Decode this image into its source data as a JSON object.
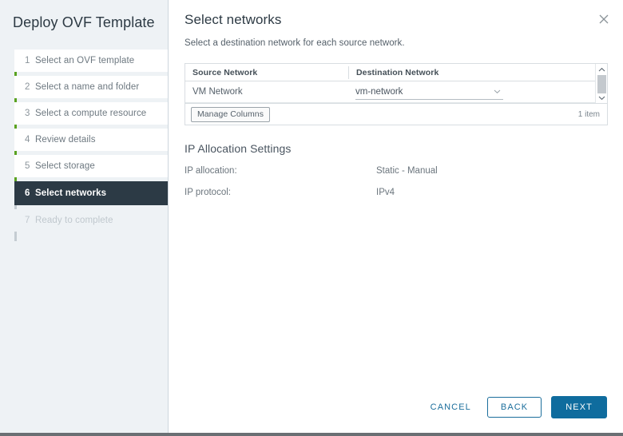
{
  "wizard": {
    "title": "Deploy OVF Template",
    "close_icon": "close-icon",
    "steps": [
      {
        "num": "1",
        "label": "Select an OVF template",
        "state": "done"
      },
      {
        "num": "2",
        "label": "Select a name and folder",
        "state": "done"
      },
      {
        "num": "3",
        "label": "Select a compute resource",
        "state": "done"
      },
      {
        "num": "4",
        "label": "Review details",
        "state": "done"
      },
      {
        "num": "5",
        "label": "Select storage",
        "state": "done"
      },
      {
        "num": "6",
        "label": "Select networks",
        "state": "active"
      },
      {
        "num": "7",
        "label": "Ready to complete",
        "state": "disabled"
      }
    ]
  },
  "page": {
    "title": "Select networks",
    "subtitle": "Select a destination network for each source network."
  },
  "networks_table": {
    "columns": [
      "Source Network",
      "Destination Network"
    ],
    "rows": [
      {
        "source": "VM Network",
        "destination": "vm-network"
      }
    ],
    "destination_chevron_icon": "chevron-down-icon",
    "scrollbar": {
      "up_icon": "chevron-up-icon",
      "down_icon": "chevron-down-icon"
    },
    "manage_columns_label": "Manage Columns",
    "item_count": "1 item"
  },
  "ip_allocation": {
    "section_title": "IP Allocation Settings",
    "rows": [
      {
        "key": "IP allocation:",
        "value": "Static - Manual"
      },
      {
        "key": "IP protocol:",
        "value": "IPv4"
      }
    ]
  },
  "footer": {
    "cancel_label": "CANCEL",
    "back_label": "BACK",
    "next_label": "NEXT"
  },
  "colors": {
    "accent_blue": "#0f6c9e",
    "progress_green": "#5aa220",
    "active_step_bg": "#2c3a45",
    "sidebar_bg": "#eef2f5"
  }
}
